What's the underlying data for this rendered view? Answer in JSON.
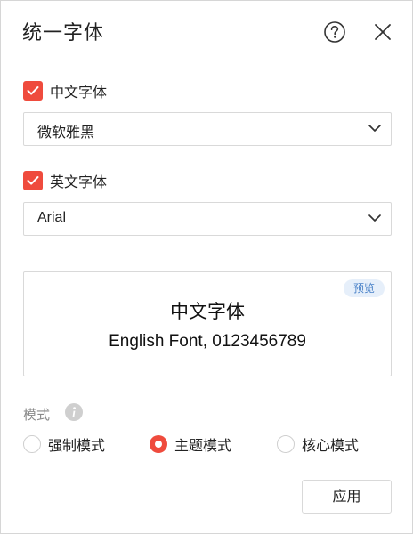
{
  "dialog": {
    "title": "统一字体",
    "help_icon": "question-circle-icon",
    "close_icon": "close-icon"
  },
  "chinese_font": {
    "label": "中文字体",
    "checked": true,
    "selected": "微软雅黑"
  },
  "english_font": {
    "label": "英文字体",
    "checked": true,
    "selected": "Arial"
  },
  "preview": {
    "badge": "预览",
    "chinese_text": "中文字体",
    "english_text": "English Font, 0123456789"
  },
  "mode": {
    "label": "模式",
    "info_icon": "info-icon",
    "options": [
      {
        "label": "强制模式",
        "selected": false
      },
      {
        "label": "主题模式",
        "selected": true
      },
      {
        "label": "核心模式",
        "selected": false
      }
    ]
  },
  "apply_label": "应用",
  "colors": {
    "accent": "#ef4b3d",
    "badge_bg": "#e6effa",
    "badge_text": "#4a82c8",
    "border": "#d9d9d9",
    "muted_text": "#8a8a8a"
  }
}
